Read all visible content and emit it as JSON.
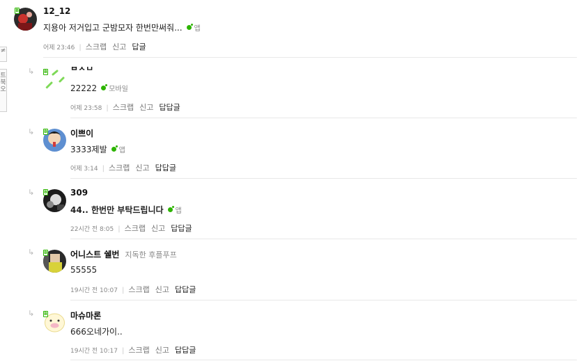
{
  "side_tabs": {
    "top": "≠",
    "bottom": "트북오"
  },
  "actions": {
    "scrap": "스크랩",
    "report": "신고"
  },
  "comments": [
    {
      "nick": "12_12",
      "title": "",
      "text": "지용아 저거입고 군밤모자 한번만써줘...",
      "source": "앱",
      "time": "어제 23:46",
      "reply": "답글"
    },
    {
      "nick": "ㅂㅈㅁ",
      "title": "",
      "text": "22222",
      "source": "모바일",
      "time": "어제 23:58",
      "reply": "답답글"
    },
    {
      "nick": "이쁘이",
      "title": "",
      "text": "3333제발",
      "source": "앱",
      "time": "어제 3:14",
      "reply": "답답글"
    },
    {
      "nick": "309",
      "title": "",
      "text": "44.. 한번만 부탁드립니다",
      "source": "앱",
      "time": "22시간 전 8:05",
      "reply": "답답글"
    },
    {
      "nick": "어니스트 쉘번",
      "title": "지독한 후플푸프",
      "text": "55555",
      "source": "",
      "time": "19시간 전 10:07",
      "reply": "답답글"
    },
    {
      "nick": "마슈마론",
      "title": "",
      "text": "666오네가이..",
      "source": "",
      "time": "19시간 전 10:17",
      "reply": "답답글"
    }
  ],
  "colors": {
    "accent_green": "#2db400",
    "divider": "#e8e8e8"
  }
}
